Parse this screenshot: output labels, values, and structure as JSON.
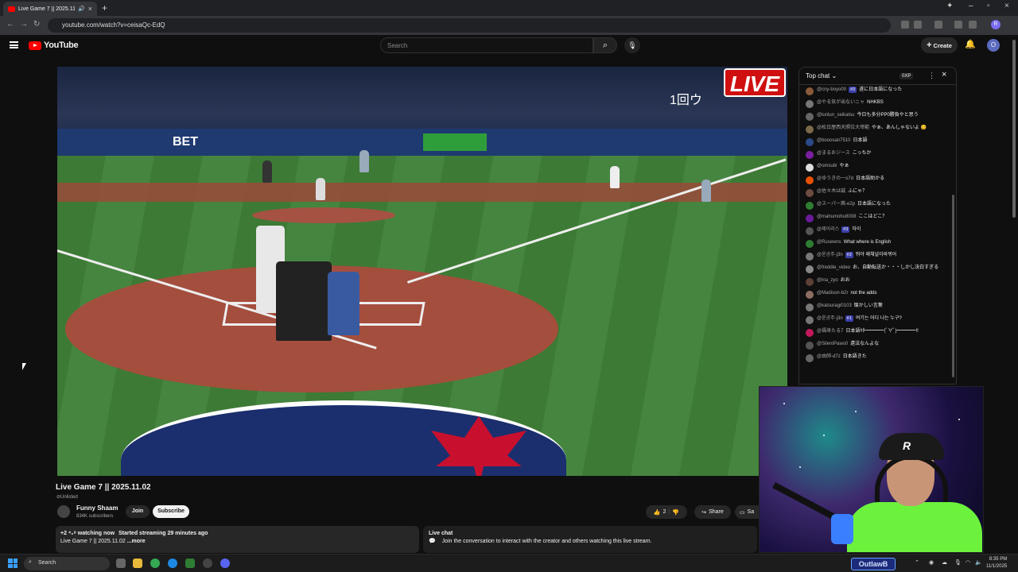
{
  "browser": {
    "tab_title": "Live Game 7 || 2025.11.02",
    "url": "youtube.com/watch?v=ceisaQc-EdQ",
    "profile_initial": "R"
  },
  "youtube": {
    "logo_text": "YouTube",
    "search_placeholder": "Search",
    "create_label": "Create",
    "avatar_initial": "O"
  },
  "video": {
    "live_label": "LIVE",
    "overlay_text": "1回ウ",
    "banner_text": "BET",
    "title": "Live Game 7 || 2025.11.02",
    "visibility": "Unlisted"
  },
  "channel": {
    "name": "Funny Shaam",
    "subscribers": "834K subscribers",
    "join_label": "Join",
    "subscribe_label": "Subscribe"
  },
  "actions": {
    "likes": "2",
    "share_label": "Share",
    "save_label": "Sa"
  },
  "description": {
    "watching": "+2 ⁴₂⁸ watching now",
    "started": "Started streaming 29 minutes ago",
    "text": "Live Game 7 || 2025.11.02",
    "more": "...more"
  },
  "live_chat_bar": {
    "title": "Live chat",
    "text": "Join the conversation to interact with the creator and others watching this live stream."
  },
  "chat": {
    "header": "Top chat",
    "xp_label": "0XP",
    "messages": [
      {
        "author": "@cny-boyo00",
        "badge": "#3",
        "text": "遂に日本語になった",
        "color": "#8a5a3a"
      },
      {
        "author": "@やる気が出ないニャ",
        "badge": "",
        "text": "NHKBS",
        "color": "#777"
      },
      {
        "author": "@lunlun_seikatsu",
        "badge": "",
        "text": "今日も多分PP0勝負やと思う",
        "color": "#666"
      },
      {
        "author": "@松日歴西天照位大帝範",
        "badge": "",
        "text": "やぁ、あんしゃないよ 😊",
        "color": "#7a6a4a"
      },
      {
        "author": "@booosan7510",
        "badge": "",
        "text": "日本語",
        "color": "#2a4a8a"
      },
      {
        "author": "@まるおジース",
        "badge": "",
        "text": "こっちか",
        "color": "#7b1fa2"
      },
      {
        "author": "@omsubi",
        "badge": "",
        "text": "やぁ",
        "color": "#ddd"
      },
      {
        "author": "@ゆうきのーo7d",
        "badge": "",
        "text": "日本語助かる",
        "color": "#e65100"
      },
      {
        "author": "@佐々木は誠",
        "badge": "",
        "text": "ふにゃ？",
        "color": "#6d4c41"
      },
      {
        "author": "@スーパー茜-e2p",
        "badge": "",
        "text": "日本語になった",
        "color": "#2e7d32"
      },
      {
        "author": "@mahumohu8008",
        "badge": "",
        "text": "ここはどこ？",
        "color": "#6a1b9a"
      },
      {
        "author": "@제이리스",
        "badge": "#3",
        "text": "하이",
        "color": "#555"
      },
      {
        "author": "@Rusewns",
        "badge": "",
        "text": "What where is English",
        "color": "#2e7d32"
      },
      {
        "author": "@윤공주-j3n",
        "badge": "#2",
        "text": "뭐야 왜채널이바뀌어",
        "color": "#777"
      },
      {
        "author": "@freddie_video",
        "badge": "",
        "text": "お、自動転送か・・・しかし決白すぎる",
        "color": "#888"
      },
      {
        "author": "@ina_zyo",
        "badge": "",
        "text": "おお",
        "color": "#5d4037"
      },
      {
        "author": "@Madison-b2r",
        "badge": "",
        "text": "not the adds",
        "color": "#8d6e63"
      },
      {
        "author": "@katsuragi0103",
        "badge": "",
        "text": "懐かしい言葉",
        "color": "#777"
      },
      {
        "author": "@윤공주-j3n",
        "badge": "#1",
        "text": "여기는 어디 나는 누구?",
        "color": "#777"
      },
      {
        "author": "@福来たる7",
        "badge": "",
        "text": "日本語ｷﾀ━━━━(ﾟ∀ﾟ)━━━━!!",
        "color": "#c2185b"
      },
      {
        "author": "@SilentPaws0",
        "badge": "",
        "text": "遠法なんよな",
        "color": "#555"
      },
      {
        "author": "@由帥-d7z",
        "badge": "",
        "text": "日本語きた",
        "color": "#666"
      }
    ]
  },
  "taskbar": {
    "search_label": "Search",
    "time": "8:35 PM",
    "date": "11/1/2025"
  },
  "watermark": "OutlawB"
}
